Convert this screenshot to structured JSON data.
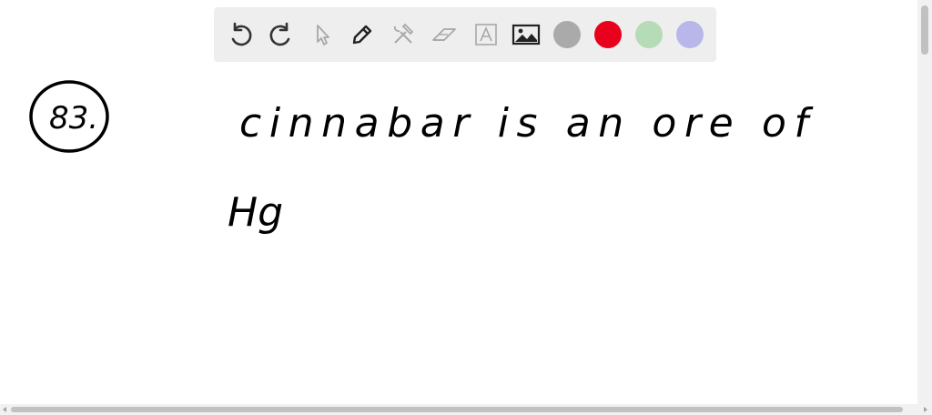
{
  "toolbar": {
    "tools": [
      {
        "name": "undo",
        "icon": "undo-icon"
      },
      {
        "name": "redo",
        "icon": "redo-icon"
      },
      {
        "name": "select",
        "icon": "cursor-icon"
      },
      {
        "name": "pen",
        "icon": "pen-icon"
      },
      {
        "name": "tools",
        "icon": "tools-icon"
      },
      {
        "name": "eraser",
        "icon": "eraser-icon"
      },
      {
        "name": "text",
        "icon": "text-box-icon"
      },
      {
        "name": "image",
        "icon": "image-icon"
      }
    ],
    "colors": [
      "#aaaaaa",
      "#e8001c",
      "#b6dbb7",
      "#b9b7ea"
    ]
  },
  "board": {
    "problem_number": "83.",
    "line1": "cinnabar is an ore of",
    "line2": "Hg"
  }
}
